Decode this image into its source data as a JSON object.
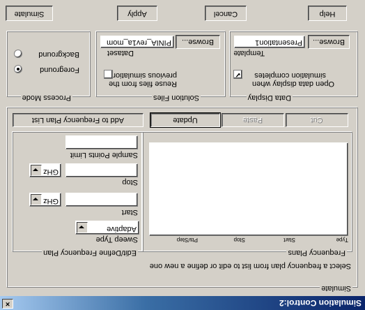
{
  "window": {
    "title": "Simulation Control:2",
    "close_glyph": "×"
  },
  "simulate_group": {
    "legend": "Simulate",
    "instruction": "Select a frequency plan from list to edit or define a new one",
    "frequency_plans": {
      "legend": "Frequency Plans",
      "columns": [
        "Type",
        "Start",
        "Stop",
        "Pts/Step"
      ],
      "rows": []
    },
    "buttons": {
      "cut": "Cut",
      "paste": "Paste",
      "update": "Update",
      "add": "Add to Frequency Plan List"
    },
    "edit_plan": {
      "legend": "Edit/Define Frequency Plan",
      "sweep_type_label": "Sweep Type",
      "sweep_type_value": "Adaptive",
      "start_label": "Start",
      "start_value": "",
      "start_unit": "GHz",
      "stop_label": "Stop",
      "stop_value": "",
      "stop_unit": "GHz",
      "sample_points_label": "Sample Points Limit",
      "sample_points_value": ""
    }
  },
  "process_mode": {
    "legend": "Process Mode",
    "options": [
      {
        "label": "Foreground",
        "selected": true
      },
      {
        "label": "Background",
        "selected": false
      }
    ]
  },
  "solution_files": {
    "legend": "Solution Files",
    "reuse_label_line1": "Reuse files from the",
    "reuse_label_line2": "previous simulation",
    "reuse_checked": false,
    "dataset_label": "Dataset",
    "dataset_value": "PINIA_rev1a_mom",
    "browse_label": "Browse..."
  },
  "data_display": {
    "legend": "Data Display",
    "open_label_line1": "Open data display when",
    "open_label_line2": "simulation completes",
    "open_checked": true,
    "template_label": "Template",
    "template_value": "Presentation1",
    "browse_label": "Browse..."
  },
  "footer": {
    "simulate": "Simulate",
    "apply": "Apply",
    "cancel": "Cancel",
    "help": "Help"
  }
}
